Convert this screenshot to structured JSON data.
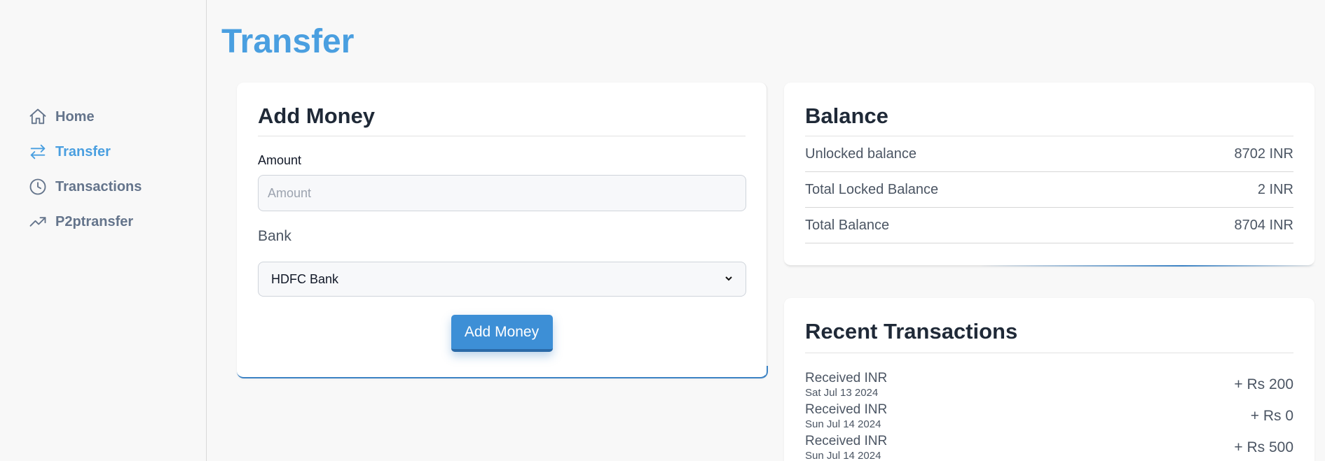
{
  "sidebar": {
    "items": [
      {
        "label": "Home",
        "icon": "home-icon",
        "active": false
      },
      {
        "label": "Transfer",
        "icon": "transfer-icon",
        "active": true
      },
      {
        "label": "Transactions",
        "icon": "clock-icon",
        "active": false
      },
      {
        "label": "P2ptransfer",
        "icon": "trending-up-icon",
        "active": false
      }
    ]
  },
  "page": {
    "title": "Transfer"
  },
  "add_money": {
    "title": "Add Money",
    "amount_label": "Amount",
    "amount_placeholder": "Amount",
    "bank_label": "Bank",
    "bank_selected": "HDFC Bank",
    "button_label": "Add Money"
  },
  "balance": {
    "title": "Balance",
    "rows": [
      {
        "label": "Unlocked balance",
        "value": "8702 INR"
      },
      {
        "label": "Total Locked Balance",
        "value": "2 INR"
      },
      {
        "label": "Total Balance",
        "value": "8704 INR"
      }
    ]
  },
  "recent": {
    "title": "Recent Transactions",
    "items": [
      {
        "title": "Received INR",
        "date": "Sat Jul 13 2024",
        "amount": "+ Rs 200"
      },
      {
        "title": "Received INR",
        "date": "Sun Jul 14 2024",
        "amount": "+ Rs 0"
      },
      {
        "title": "Received INR",
        "date": "Sun Jul 14 2024",
        "amount": "+ Rs 500"
      }
    ]
  },
  "colors": {
    "accent": "#4a9fe0",
    "button": "#3d8fd6",
    "muted": "#64748b"
  }
}
